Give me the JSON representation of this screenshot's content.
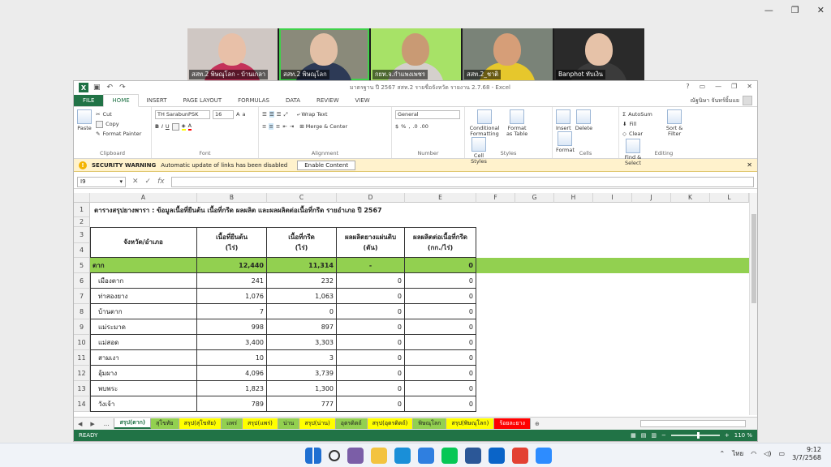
{
  "zoom_window": {
    "controls": [
      "—",
      "❐",
      "✕"
    ]
  },
  "participants": [
    {
      "name": "สสท.2 พิษณุโลก - บ้านเกลา",
      "bg": "#cfc7c3",
      "skin": "#e8c0a8",
      "shirt": "#c4325a",
      "active": false
    },
    {
      "name": "สสท.2 พิษณุโลก",
      "bg": "#8a8a7a",
      "skin": "#e3c0a6",
      "shirt": "#2d3a56",
      "active": true
    },
    {
      "name": "กยท.จ.กำแพงเพชร",
      "bg": "#a7e267",
      "skin": "#c99a74",
      "shirt": "#d4d0cc",
      "active": false
    },
    {
      "name": "สสท.2_ชาติ",
      "bg": "#7a8378",
      "skin": "#d69e78",
      "shirt": "#e6c72c",
      "active": false
    },
    {
      "name": "Banphot ทับเงิน",
      "bg": "#2a2a2a",
      "skin": "#e6c2a8",
      "shirt": "#3b3b3b",
      "active": false
    }
  ],
  "excel": {
    "doc_title": "มาตรฐาน ปี 2567 สสท.2 รายชื่อจังหวัด รายงาน 2.7.68 - Excel",
    "title_ctrls": [
      "?",
      "▭",
      "—",
      "❐",
      "✕"
    ],
    "tabs": [
      "FILE",
      "HOME",
      "INSERT",
      "PAGE LAYOUT",
      "FORMULAS",
      "DATA",
      "REVIEW",
      "VIEW"
    ],
    "user_name": "ณัฐนิษา จันทร์ยิ้มแย",
    "ribbon": {
      "paste": "Paste",
      "cut": "Cut",
      "copy": "Copy",
      "format_painter": "Format Painter",
      "clipboard": "Clipboard",
      "font_name": "TH SarabunPSK",
      "font_size": "16",
      "font_group": "Font",
      "wrap_text": "Wrap Text",
      "merge_center": "Merge & Center",
      "alignment": "Alignment",
      "number_format": "General",
      "number": "Number",
      "conditional": "Conditional Formatting",
      "format_table": "Format as Table",
      "cell_styles": "Cell Styles",
      "styles": "Styles",
      "insert": "Insert",
      "delete": "Delete",
      "format": "Format",
      "cells": "Cells",
      "autosum": "AutoSum",
      "fill": "Fill",
      "clear": "Clear",
      "sort_filter": "Sort & Filter",
      "find_select": "Find & Select",
      "editing": "Editing"
    },
    "security": {
      "label": "SECURITY WARNING",
      "message": "Automatic update of links has been disabled",
      "button": "Enable Content"
    },
    "name_box": "I9",
    "fx": "fx",
    "columns": [
      "A",
      "B",
      "C",
      "D",
      "E",
      "F",
      "G",
      "H",
      "I",
      "J",
      "K",
      "L"
    ],
    "sheet_title": "ตารางสรุปยางพารา : ข้อมูลเนื้อที่ยืนต้น เนื้อที่กรีด ผลผลิต และผลผลิตต่อเนื้อที่กรีด รายอำเภอ ปี 2567",
    "table_headers": [
      "จังหวัด/อำเภอ",
      "เนื้อที่ยืนต้น",
      "เนื้อที่กรีด",
      "ผลผลิตยางแผ่นดิบ",
      "ผลผลิตต่อเนื้อที่กรีด"
    ],
    "table_units": [
      "",
      "(ไร่)",
      "(ไร่)",
      "(ตัน)",
      "(กก./ไร่)"
    ],
    "province_row": [
      "ตาก",
      "12,440",
      "11,314",
      "-",
      "0"
    ],
    "rows": [
      [
        "เมืองตาก",
        "241",
        "232",
        "0",
        "0"
      ],
      [
        "ท่าสองยาง",
        "1,076",
        "1,063",
        "0",
        "0"
      ],
      [
        "บ้านตาก",
        "7",
        "0",
        "0",
        "0"
      ],
      [
        "แม่ระมาด",
        "998",
        "897",
        "0",
        "0"
      ],
      [
        "แม่สอด",
        "3,400",
        "3,303",
        "0",
        "0"
      ],
      [
        "สามเงา",
        "10",
        "3",
        "0",
        "0"
      ],
      [
        "อุ้มผาง",
        "4,096",
        "3,739",
        "0",
        "0"
      ],
      [
        "พบพระ",
        "1,823",
        "1,300",
        "0",
        "0"
      ],
      [
        "วังเจ้า",
        "789",
        "777",
        "0",
        "0"
      ]
    ],
    "row_numbers": [
      "1",
      "2",
      "3",
      "4",
      "5",
      "6",
      "7",
      "8",
      "9",
      "10",
      "11",
      "12",
      "13",
      "14"
    ],
    "sheet_tabs": [
      {
        "label": "...",
        "color": "#f3f3f3"
      },
      {
        "label": "สรุป(ตาก)",
        "color": "#ffffff",
        "active": true
      },
      {
        "label": "สุโขทัย",
        "color": "#92d050"
      },
      {
        "label": "สรุป(สุโขทัย)",
        "color": "#ffff00"
      },
      {
        "label": "แพร่",
        "color": "#92d050"
      },
      {
        "label": "สรุป(แพร่)",
        "color": "#ffff00"
      },
      {
        "label": "น่าน",
        "color": "#92d050"
      },
      {
        "label": "สรุป(น่าน)",
        "color": "#ffff00"
      },
      {
        "label": "อุตรดิตถ์",
        "color": "#92d050"
      },
      {
        "label": "สรุป(อุตรดิตถ์)",
        "color": "#ffff00"
      },
      {
        "label": "พิษณุโลก",
        "color": "#92d050"
      },
      {
        "label": "สรุป(พิษณุโลก)",
        "color": "#ffff00"
      },
      {
        "label": "ร้อยละยาง",
        "color": "#ff0000"
      }
    ],
    "status": "READY",
    "zoom": "110 %"
  },
  "taskbar": {
    "icons": [
      {
        "name": "windows-start-icon",
        "color": "#1f6fd1"
      },
      {
        "name": "search-icon",
        "color": "#f0f3f8"
      },
      {
        "name": "widgets-icon",
        "color": "#7b5ea7"
      },
      {
        "name": "file-explorer-icon",
        "color": "#f3c33f"
      },
      {
        "name": "edge-icon",
        "color": "#1a8fd8"
      },
      {
        "name": "store-icon",
        "color": "#2f7fe0"
      },
      {
        "name": "line-icon",
        "color": "#06c755"
      },
      {
        "name": "word-icon",
        "color": "#2b5797"
      },
      {
        "name": "outlook-icon",
        "color": "#0a64c8"
      },
      {
        "name": "chrome-icon",
        "color": "#e34133"
      },
      {
        "name": "zoom-icon",
        "color": "#2d8cff"
      }
    ],
    "lang": "ไทย",
    "time": "9:12",
    "date": "3/7/2568"
  }
}
